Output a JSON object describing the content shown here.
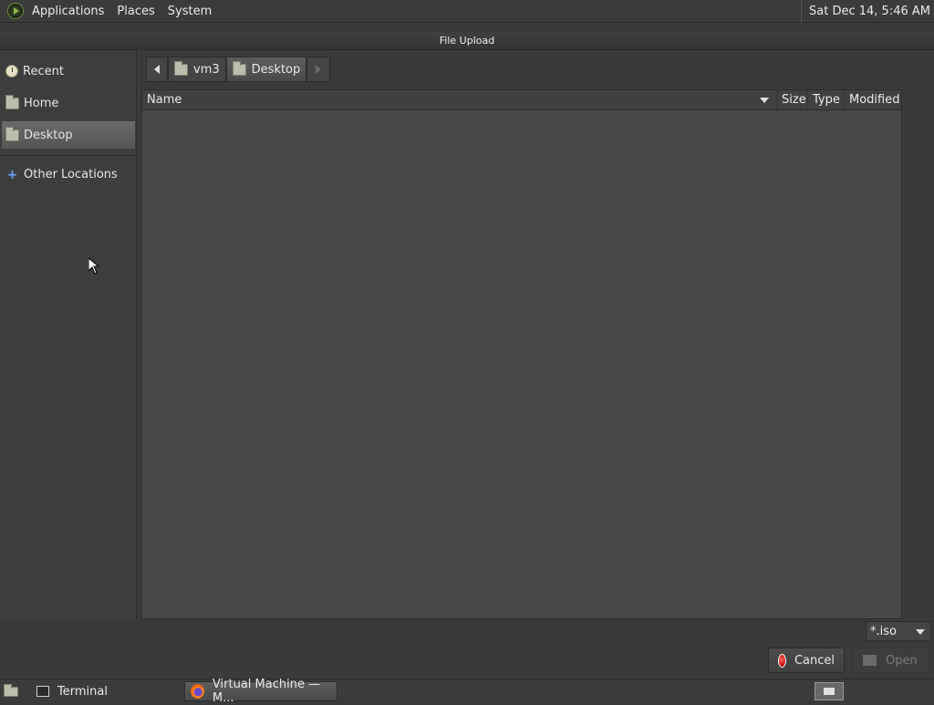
{
  "top_panel": {
    "menus": [
      "Applications",
      "Places",
      "System"
    ],
    "clock": "Sat Dec 14,  5:46 AM"
  },
  "dialog": {
    "title": "File Upload"
  },
  "sidebar": {
    "items": [
      {
        "label": "Recent",
        "icon": "clock-icon"
      },
      {
        "label": "Home",
        "icon": "folder-home-icon"
      },
      {
        "label": "Desktop",
        "icon": "folder-desktop-icon",
        "selected": true
      },
      {
        "label": "Other Locations",
        "icon": "plus-icon"
      }
    ]
  },
  "pathbar": {
    "segments": [
      "vm3",
      "Desktop"
    ]
  },
  "filelist": {
    "columns": [
      "Name",
      "Size",
      "Type",
      "Modified"
    ],
    "rows": []
  },
  "filter": {
    "value": "*.iso"
  },
  "buttons": {
    "cancel": "Cancel",
    "open": "Open"
  },
  "taskbar": {
    "tasks": [
      "Terminal",
      "Virtual Machine — M..."
    ]
  }
}
